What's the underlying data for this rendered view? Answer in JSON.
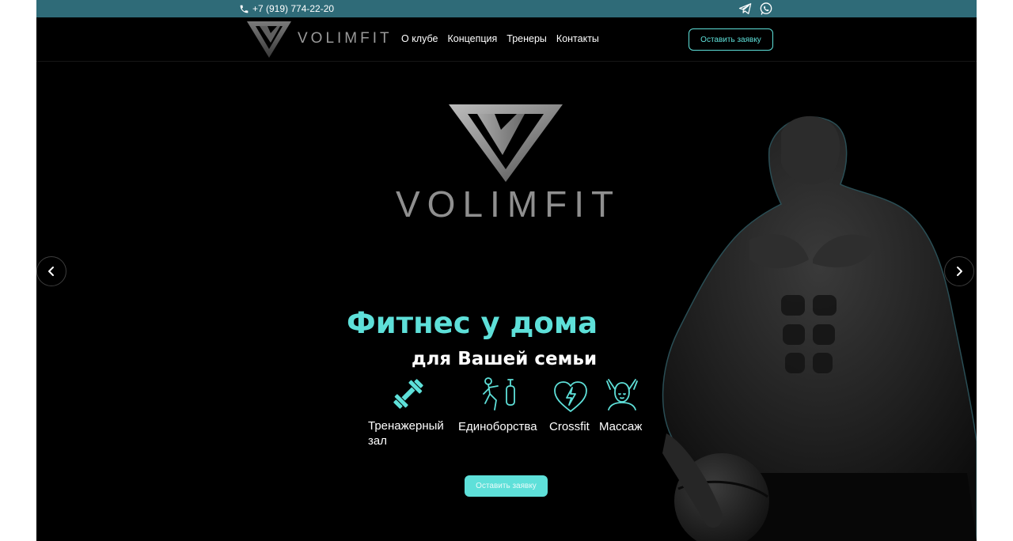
{
  "topbar": {
    "phone": "+7 (919) 774-22-20",
    "icons": [
      "phone-icon",
      "telegram-icon",
      "whatsapp-icon"
    ],
    "background": "#2f6b78"
  },
  "navbar": {
    "brand": "VOLIMFIT",
    "menu": [
      "О клубе",
      "Концепция",
      "Тренеры",
      "Контакты"
    ],
    "cta": "Оставить заявку"
  },
  "hero": {
    "brand": "VOLIMFIT",
    "title": "Фитнес у дома",
    "subtitle": "для Вашей семьи",
    "services": [
      {
        "label": "Тренажерный зал",
        "icon": "dumbbell-icon"
      },
      {
        "label": "Единоборства",
        "icon": "boxing-icon"
      },
      {
        "label": "Crossfit",
        "icon": "heart-bolt-icon"
      },
      {
        "label": "Массаж",
        "icon": "massage-icon"
      }
    ],
    "cta": "Оставить заявку",
    "prev_icon": "chevron-left-icon",
    "next_icon": "chevron-right-icon"
  },
  "colors": {
    "accent": "#5ee0d9",
    "background": "#000000",
    "brand_gray": "#8f8f8f"
  }
}
